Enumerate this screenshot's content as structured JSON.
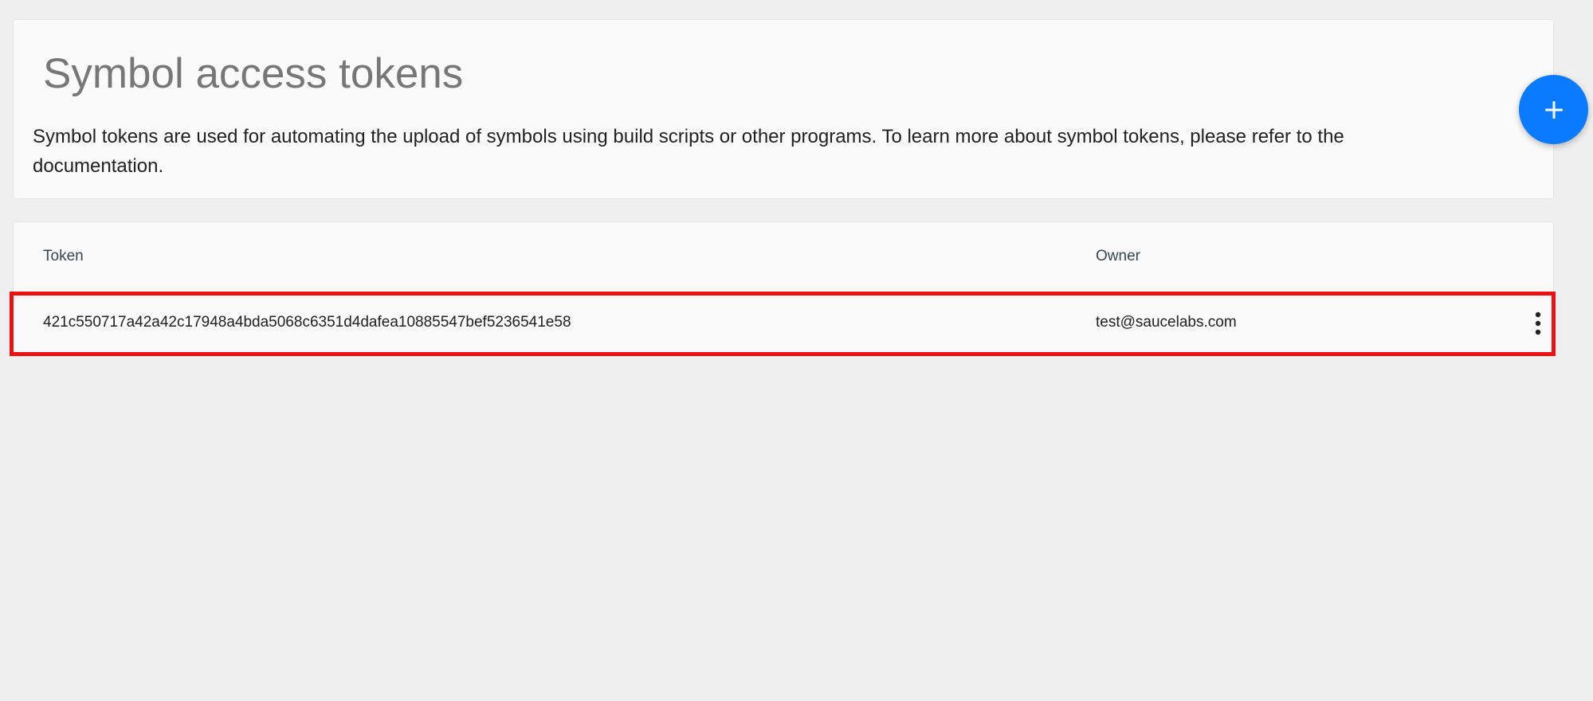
{
  "header": {
    "title": "Symbol access tokens",
    "description": "Symbol tokens are used for automating the upload of symbols using build scripts or other programs. To learn more about symbol tokens, please refer to the documentation."
  },
  "actions": {
    "add_button_icon": "plus-icon",
    "accent_color": "#0a7bff"
  },
  "table": {
    "columns": [
      "Token",
      "Owner"
    ],
    "rows": [
      {
        "token": "421c550717a42a42c17948a4bda5068c6351d4dafea10885547bef5236541e58",
        "owner": "test@saucelabs.com",
        "menu_icon": "more-vertical-icon"
      }
    ],
    "highlight_color": "#ee1111"
  }
}
